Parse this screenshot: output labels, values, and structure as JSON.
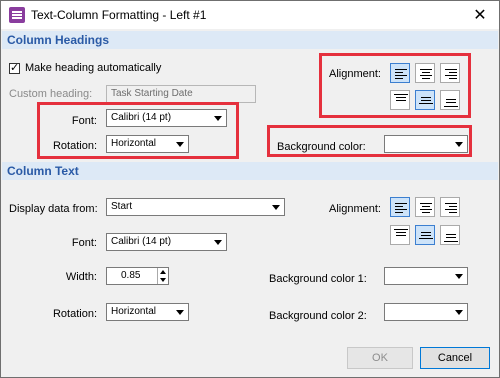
{
  "window": {
    "title": "Text-Column Formatting - Left #1",
    "close_label": "✕"
  },
  "headings": {
    "section_title": "Column Headings",
    "make_heading_label": "Make heading automatically",
    "make_heading_checked": true,
    "custom_heading_label": "Custom heading:",
    "custom_heading_value": "Task Starting Date",
    "font_label": "Font:",
    "font_value": "Calibri (14 pt)",
    "rotation_label": "Rotation:",
    "rotation_value": "Horizontal",
    "alignment_label": "Alignment:",
    "background_label": "Background color:",
    "background_value": ""
  },
  "text": {
    "section_title": "Column Text",
    "display_label": "Display data from:",
    "display_value": "Start",
    "font_label": "Font:",
    "font_value": "Calibri (14 pt)",
    "width_label": "Width:",
    "width_value": "0.85",
    "rotation_label": "Rotation:",
    "rotation_value": "Horizontal",
    "alignment_label": "Alignment:",
    "background1_label": "Background color 1:",
    "background1_value": "",
    "background2_label": "Background color 2:",
    "background2_value": ""
  },
  "footer": {
    "ok_label": "OK",
    "cancel_label": "Cancel"
  },
  "colors": {
    "highlight": "#e5303d",
    "section_bg": "#dde9f6",
    "section_text": "#2a5aa6",
    "selected_btn": "#cde3f9"
  }
}
